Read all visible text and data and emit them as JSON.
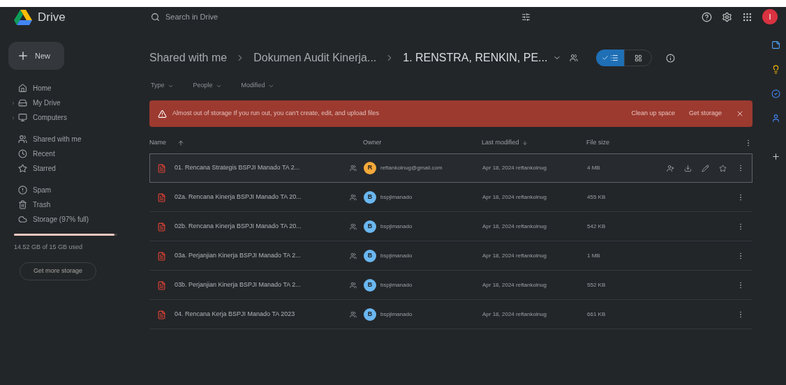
{
  "app": {
    "name": "Drive"
  },
  "search": {
    "placeholder": "Search in Drive"
  },
  "avatar": {
    "letter": "I",
    "color": "#d93240"
  },
  "sidebar": {
    "new_button": "New",
    "groups": [
      [
        {
          "label": "Home",
          "expandable": false
        },
        {
          "label": "My Drive",
          "expandable": true
        },
        {
          "label": "Computers",
          "expandable": true
        }
      ],
      [
        {
          "label": "Shared with me",
          "expandable": false
        },
        {
          "label": "Recent",
          "expandable": false
        },
        {
          "label": "Starred",
          "expandable": false
        }
      ],
      [
        {
          "label": "Spam",
          "expandable": false
        },
        {
          "label": "Trash",
          "expandable": false
        },
        {
          "label": "Storage (97% full)",
          "expandable": false
        }
      ]
    ],
    "storage": {
      "level": 0.97,
      "text": "14.52 GB of 15 GB used",
      "button": "Get more storage"
    }
  },
  "breadcrumb": [
    "Shared with me",
    "Dokumen Audit Kinerja...",
    "1. RENSTRA, RENKIN, PE..."
  ],
  "view_toggle": [
    {
      "kind": "list",
      "selected": true
    },
    {
      "kind": "grid",
      "selected": false
    }
  ],
  "filters": [
    "Type",
    "People",
    "Modified"
  ],
  "banner": {
    "message": "Almost out of storage If you run out, you can't create, edit, and upload files",
    "actions": [
      "Clean up space",
      "Get storage"
    ]
  },
  "table": {
    "columns": [
      "Name",
      "Owner",
      "Last modified",
      "File size"
    ],
    "rows": [
      {
        "name": "01. Rencana Strategis BSPJI Manado TA 2...",
        "owner_initial": "R",
        "color": "#f4a93a",
        "owner": "reftankolnug@gmail.com",
        "modified": "Apr 18, 2024 reftankolnug",
        "size": "4 MB",
        "selected": true
      },
      {
        "name": "02a. Rencana Kinerja BSPJI Manado TA 20...",
        "owner_initial": "B",
        "color": "#6ab7f0",
        "owner": "bspjimanado",
        "modified": "Apr 18, 2024 reftankolnug",
        "size": "455 KB",
        "selected": false
      },
      {
        "name": "02b. Rencana Kinerja BSPJI Manado TA 20...",
        "owner_initial": "B",
        "color": "#6ab7f0",
        "owner": "bspjimanado",
        "modified": "Apr 18, 2024 reftankolnug",
        "size": "542 KB",
        "selected": false
      },
      {
        "name": "03a. Perjanjian Kinerja BSPJI Manado TA 2...",
        "owner_initial": "B",
        "color": "#6ab7f0",
        "owner": "bspjimanado",
        "modified": "Apr 18, 2024 reftankolnug",
        "size": "1 MB",
        "selected": false
      },
      {
        "name": "03b. Perjanjian Kinerja BSPJI Manado TA 2...",
        "owner_initial": "B",
        "color": "#6ab7f0",
        "owner": "bspjimanado",
        "modified": "Apr 18, 2024 reftankolnug",
        "size": "552 KB",
        "selected": false
      },
      {
        "name": "04. Rencana Kerja BSPJI Manado TA 2023",
        "owner_initial": "B",
        "color": "#6ab7f0",
        "owner": "bspjimanado",
        "modified": "Apr 18, 2024 reftankolnug",
        "size": "661 KB",
        "selected": false
      }
    ]
  }
}
